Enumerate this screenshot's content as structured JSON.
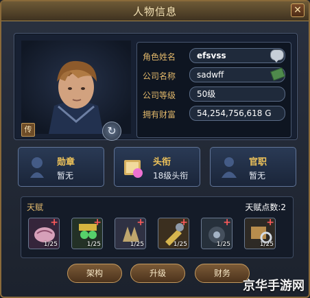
{
  "window": {
    "title": "人物信息",
    "close_symbol": "✕"
  },
  "profile": {
    "portrait_badge": "传",
    "fields": [
      {
        "label": "角色姓名",
        "value": "efsvss",
        "icon": "chat-bubble-icon"
      },
      {
        "label": "公司名称",
        "value": "sadwff",
        "icon": "money-icon"
      },
      {
        "label": "公司等级",
        "value": "50级"
      },
      {
        "label": "拥有财富",
        "value": "54,254,756,618 G"
      }
    ]
  },
  "cards": [
    {
      "title": "勋章",
      "value": "暂无",
      "icon": "medal-silhouette-icon"
    },
    {
      "title": "头衔",
      "value": "18级头衔",
      "icon": "book-gift-icon"
    },
    {
      "title": "官职",
      "value": "暂无",
      "icon": "person-silhouette-icon"
    }
  ],
  "talent": {
    "title": "天赋",
    "points": "天赋点数:2",
    "items": [
      {
        "level": "1/25",
        "icon": "brain-icon"
      },
      {
        "level": "1/25",
        "icon": "worker-goggles-icon"
      },
      {
        "level": "1/25",
        "icon": "claw-hand-icon"
      },
      {
        "level": "1/25",
        "icon": "wrench-gear-icon"
      },
      {
        "level": "1/25",
        "icon": "tire-wrench-icon"
      },
      {
        "level": "1/25",
        "icon": "books-magnifier-icon"
      }
    ]
  },
  "buttons": [
    "架构",
    "升级",
    "财务"
  ],
  "watermark": "京华手游网",
  "colors": {
    "accent_gold": "#f0c45a",
    "label_gold": "#e3b96b",
    "bg_dark": "#1c222d"
  }
}
